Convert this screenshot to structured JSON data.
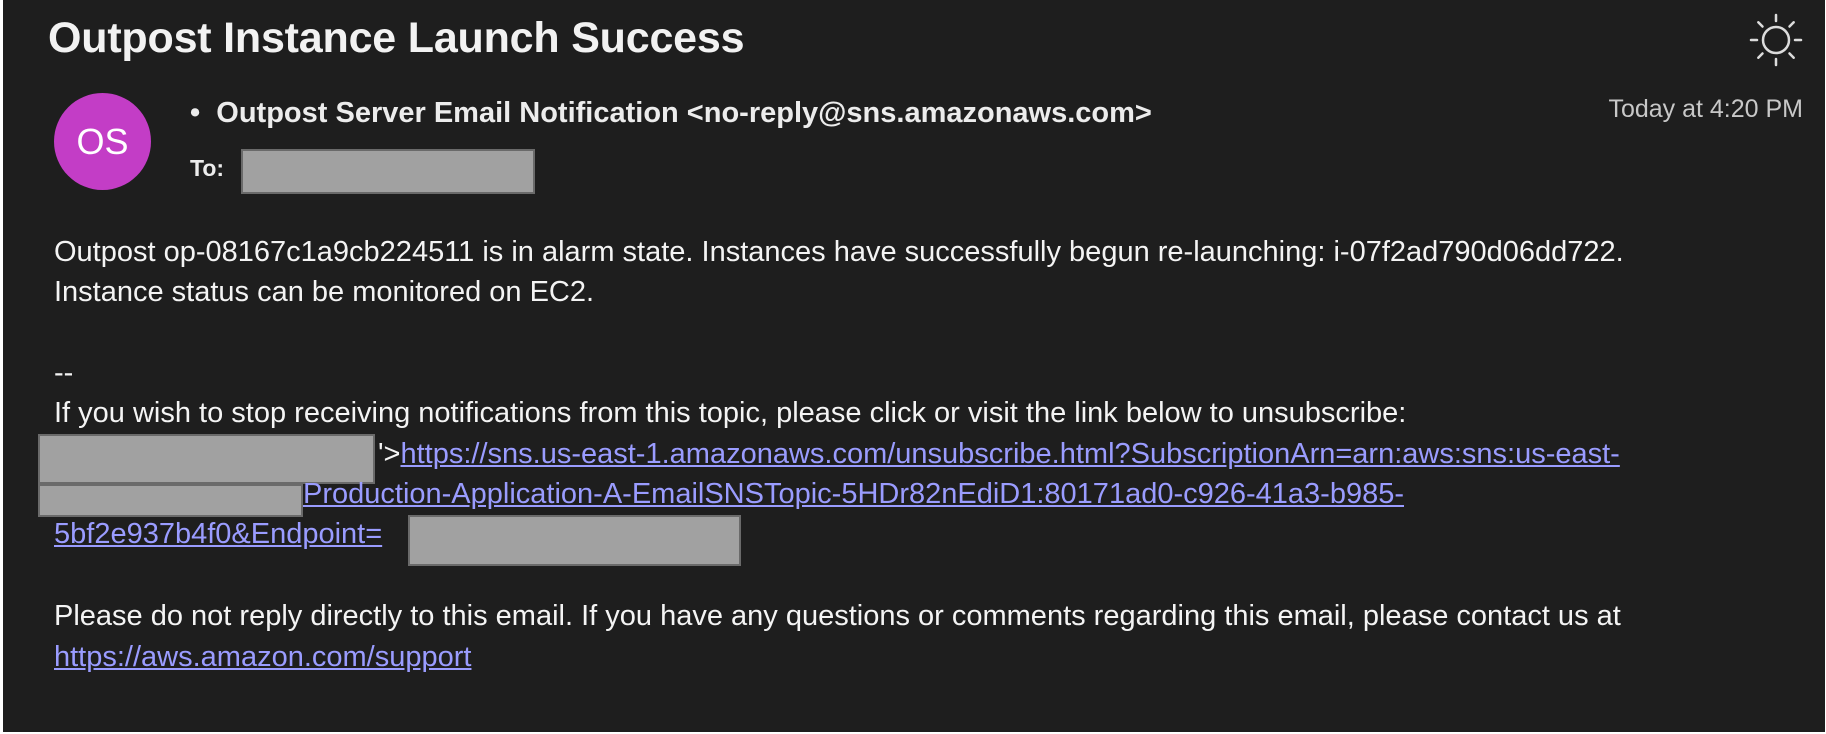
{
  "subject": "Outpost Instance Launch Success",
  "avatar_initials": "OS",
  "sender": "Outpost Server Email Notification <no-reply@sns.amazonaws.com>",
  "to_label": "To:",
  "timestamp": "Today at 4:20 PM",
  "body": {
    "line1": "Outpost op-08167c1a9cb224511 is in alarm state. Instances have successfully begun re-launching: i-07f2ad790d06dd722.",
    "line2": "Instance status can be monitored on EC2.",
    "separator": "--",
    "unsubscribe_text": "If you wish to stop receiving notifications from this topic, please click or visit the link below to unsubscribe:",
    "link_prefix": "'>",
    "unsubscribe_link_part1": "https://sns.us-east-1.amazonaws.com/unsubscribe.html?SubscriptionArn=arn:aws:sns:us-east-",
    "unsubscribe_link_part2": "Production-Application-A-EmailSNSTopic-5HDr82nEdiD1:80171ad0-c926-41a3-b985-",
    "unsubscribe_link_part3": "5bf2e937b4f0&Endpoint=",
    "footer_text": "Please do not reply directly to this email. If you have any questions or comments regarding this email, please contact us at",
    "support_link": "https://aws.amazon.com/support"
  },
  "icons": {
    "appearance": "sun-icon"
  },
  "colors": {
    "background": "#1e1e1e",
    "avatar": "#c33dc6",
    "link": "#9a9cff",
    "redaction": "#a1a1a1"
  }
}
